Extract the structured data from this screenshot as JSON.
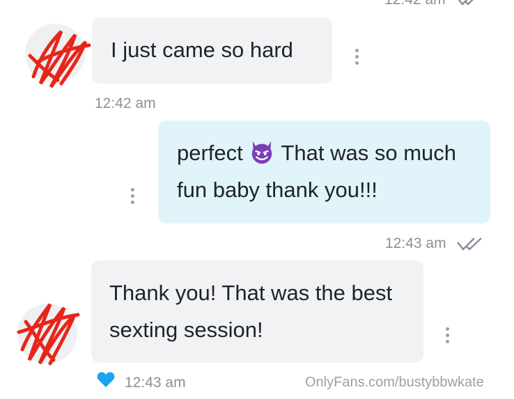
{
  "messages": [
    {
      "direction": "incoming",
      "text": "I just came so hard",
      "time": "12:42 am"
    },
    {
      "direction": "outgoing",
      "text_before_emoji": "perfect",
      "emoji": "smiling-devil-emoji",
      "text_after_emoji": "That was so much fun baby thank you!!!",
      "time": "12:43 am",
      "read_receipt": "double-check-icon"
    },
    {
      "direction": "incoming",
      "text": "Thank you! That was the best sexting session!",
      "time": "12:43 am",
      "liked": true,
      "like_icon": "heart-icon"
    }
  ],
  "top_time_partial": "12:42 am",
  "watermark": "OnlyFans.com/bustybbwkate",
  "colors": {
    "incoming_bubble": "#f0f2f4",
    "outgoing_bubble": "#e0f4fa",
    "heart": "#1aa3ee",
    "scribble": "#e8251a",
    "emoji": "#7a3fb8"
  }
}
